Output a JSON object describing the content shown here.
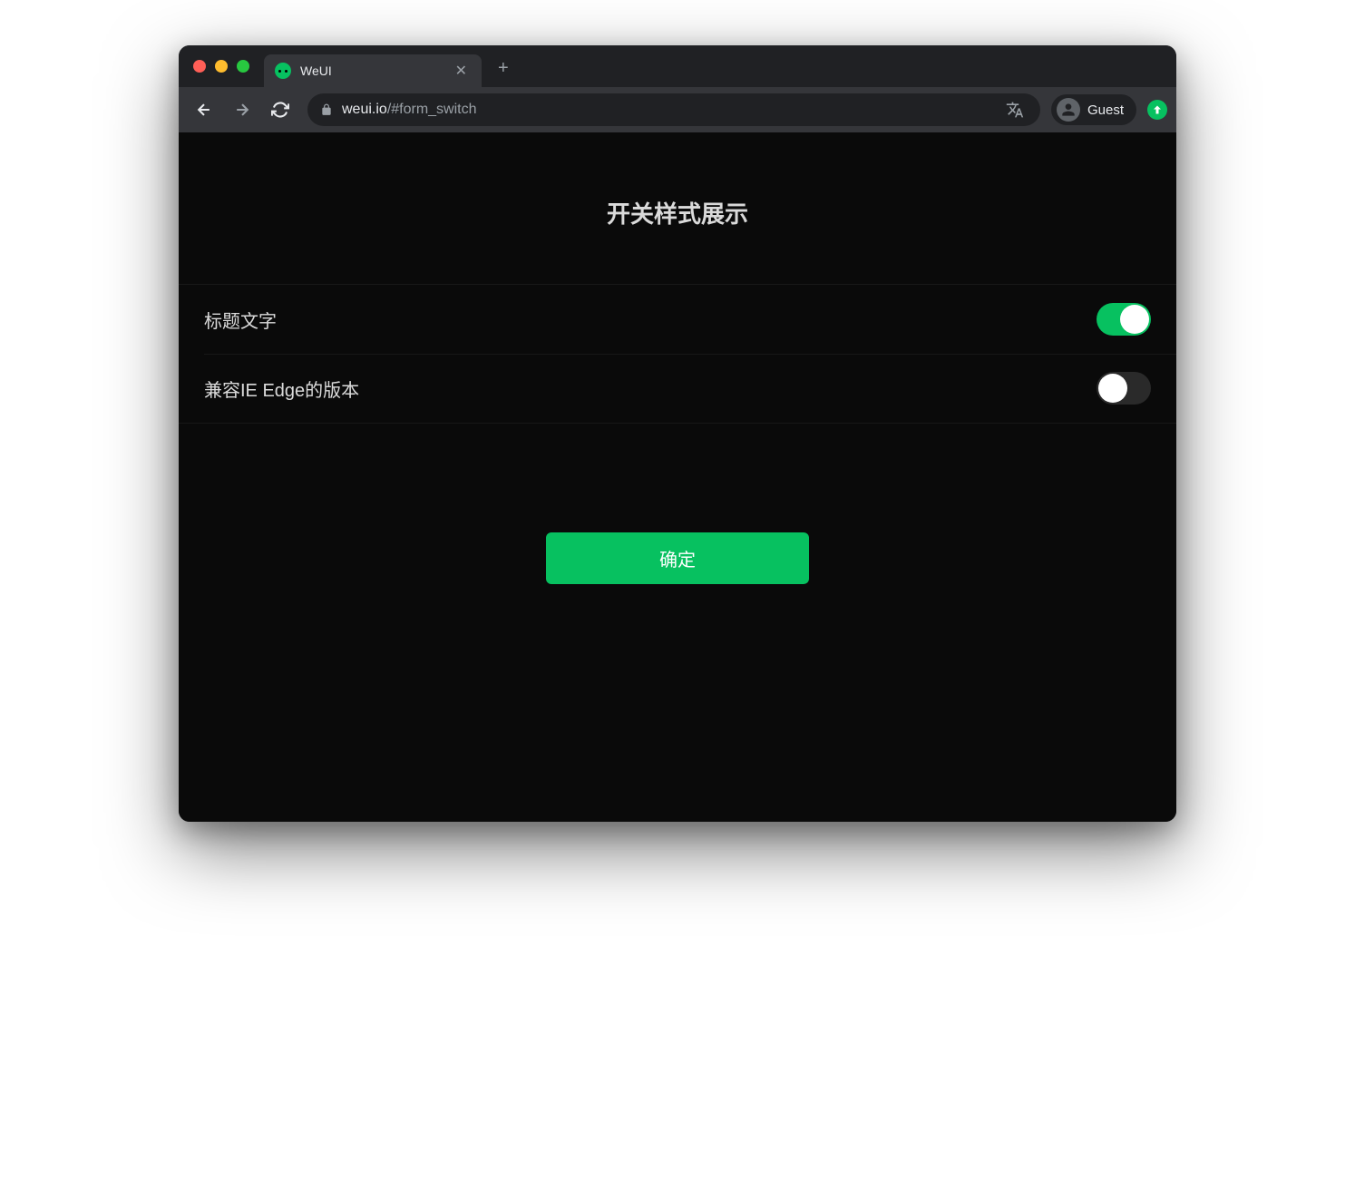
{
  "browser": {
    "tab_title": "WeUI",
    "url_host": "weui.io",
    "url_path": "/#form_switch",
    "profile_name": "Guest"
  },
  "page": {
    "title": "开关样式展示",
    "cells": [
      {
        "label": "标题文字",
        "checked": true
      },
      {
        "label": "兼容IE Edge的版本",
        "checked": false
      }
    ],
    "submit_label": "确定"
  },
  "colors": {
    "accent": "#07c160"
  }
}
